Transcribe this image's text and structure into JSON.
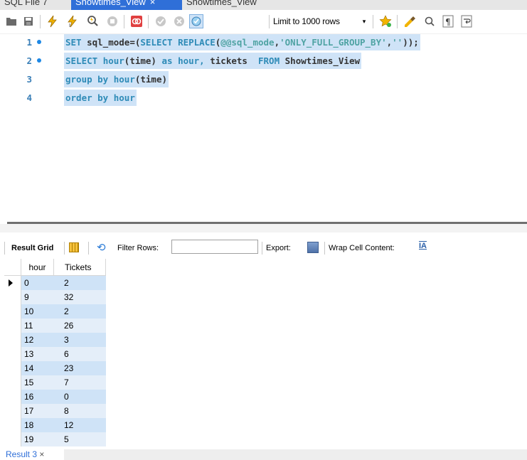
{
  "tabs": [
    {
      "label": "SQL File 7"
    },
    {
      "label": "Showtimes_View",
      "close": "×"
    },
    {
      "label": "Showtimes_View"
    }
  ],
  "toolbar": {
    "limit_label": "Limit to 1000 rows",
    "limit_arrow": "▾"
  },
  "editor": {
    "lines": [
      {
        "num": "1",
        "bullet": true
      },
      {
        "num": "2",
        "bullet": true
      },
      {
        "num": "3",
        "bullet": false
      },
      {
        "num": "4",
        "bullet": false
      }
    ],
    "tokens": {
      "l1_set": "SET",
      "l1_var": "sql_mode",
      "l1_eq": "=(",
      "l1_select": "SELECT",
      "l1_replace": "REPLACE",
      "l1_paren": "(",
      "l1_at": "@@",
      "l1_sys": "sql_mode",
      "l1_comma": ",",
      "l1_str": "'ONLY_FULL_GROUP_BY'",
      "l1_comma2": ",",
      "l1_str2": "''",
      "l1_close": "));",
      "l2_select": "SELECT",
      "l2_hour": "hour",
      "l2_args": "(time)",
      "l2_as": "as",
      "l2_alias": "hour,",
      "l2_tickets": "tickets",
      "l2_from": "FROM",
      "l2_table": "Showtimes_View",
      "l3_group": "group by",
      "l3_hour": "hour",
      "l3_args": "(time)",
      "l4_order": "order by",
      "l4_hour": "hour"
    }
  },
  "result_toolbar": {
    "result_grid": "Result Grid",
    "filter_rows": "Filter Rows:",
    "filter_value": "",
    "export": "Export:",
    "wrap": "Wrap Cell Content:",
    "wrap_icon": "IA"
  },
  "grid": {
    "columns": [
      "hour",
      "Tickets"
    ],
    "rows": [
      [
        "0",
        "2"
      ],
      [
        "9",
        "32"
      ],
      [
        "10",
        "2"
      ],
      [
        "11",
        "26"
      ],
      [
        "12",
        "3"
      ],
      [
        "13",
        "6"
      ],
      [
        "14",
        "23"
      ],
      [
        "15",
        "7"
      ],
      [
        "16",
        "0"
      ],
      [
        "17",
        "8"
      ],
      [
        "18",
        "12"
      ],
      [
        "19",
        "5"
      ]
    ]
  },
  "bottom_tabs": [
    {
      "label": "Result 3",
      "close": "×"
    }
  ],
  "colors": {
    "selection": "#cfe3f7",
    "keyword": "#2e8bb7",
    "tab_active": "#2f6fd8"
  }
}
